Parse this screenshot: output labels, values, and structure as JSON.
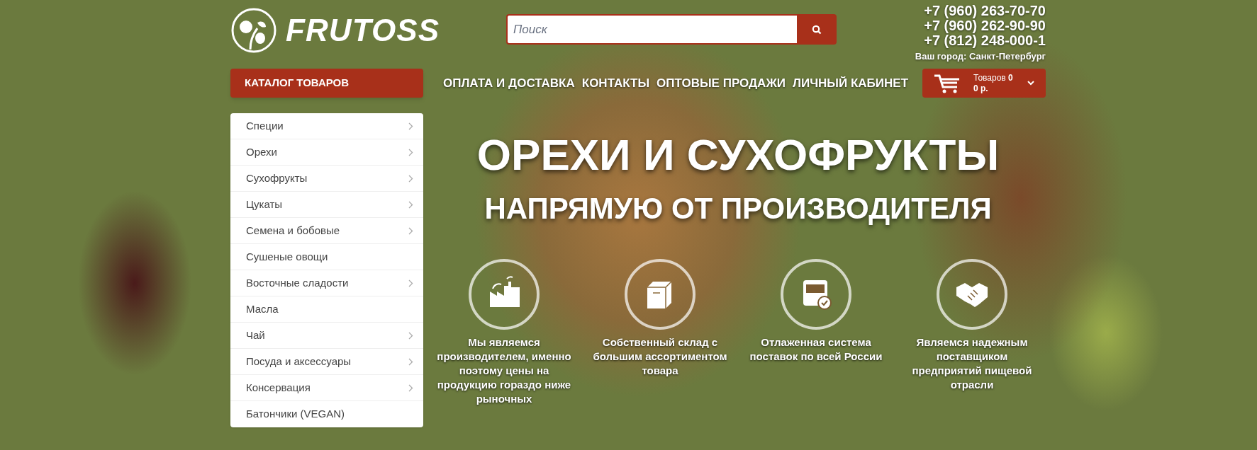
{
  "header": {
    "logo": "FRUTOSS",
    "search": {
      "placeholder": "Поиск"
    },
    "phones": [
      "+7 (960) 263-70-70",
      "+7 (960) 262-90-90",
      "+7 (812) 248-000-1"
    ],
    "city": "Ваш город: Санкт-Петербург"
  },
  "catalog_button": "КАТАЛОГ ТОВАРОВ",
  "nav": [
    "ОПЛАТА И ДОСТАВКА",
    "КОНТАКТЫ",
    "ОПТОВЫЕ ПРОДАЖИ",
    "ЛИЧНЫЙ КАБИНЕТ"
  ],
  "cart": {
    "items": "Товаров **0**",
    "total": "0 р."
  },
  "sidebar": {
    "items": [
      {
        "label": "Специи",
        "has_submenu": true
      },
      {
        "label": "Орехи",
        "has_submenu": true
      },
      {
        "label": "Сухофрукты",
        "has_submenu": true
      },
      {
        "label": "Цукаты",
        "has_submenu": true
      },
      {
        "label": "Семена и бобовые",
        "has_submenu": true
      },
      {
        "label": "Сушеные овощи",
        "has_submenu": false
      },
      {
        "label": "Восточные сладости",
        "has_submenu": true
      },
      {
        "label": "Масла",
        "has_submenu": false
      },
      {
        "label": "Чай",
        "has_submenu": true
      },
      {
        "label": "Посуда и аксессуары",
        "has_submenu": true
      },
      {
        "label": "Консервация",
        "has_submenu": true
      },
      {
        "label": "Батончики (VEGAN)",
        "has_submenu": false
      }
    ]
  },
  "hero": {
    "title": "ОРЕХИ И СУХОФРУКТЫ",
    "subtitle": "НАПРЯМУЮ ОТ ПРОИЗВОДИТЕЛЯ"
  },
  "features": [
    {
      "text": "Мы являемся производителем, именно поэтому цены на продукцию гораздо ниже рыночных"
    },
    {
      "text": "Собственный склад с большим ассортиментом товара"
    },
    {
      "text": "Отлаженная система поставок по всей России"
    },
    {
      "text": "Являемся надежным поставщиком предприятий пищевой отрасли"
    }
  ]
}
